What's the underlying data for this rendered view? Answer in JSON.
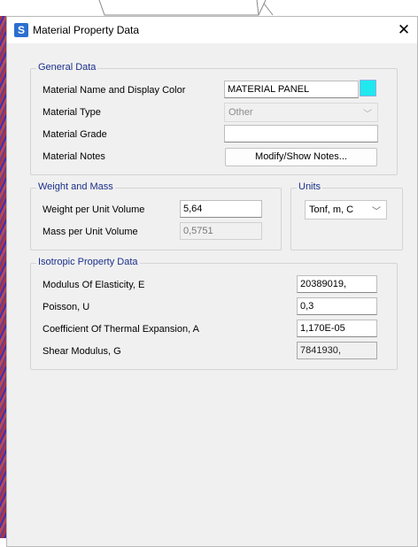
{
  "dialog": {
    "title": "Material Property Data",
    "app_icon_letter": "S"
  },
  "general": {
    "legend": "General Data",
    "name_label": "Material Name and Display Color",
    "name_value": "MATERIAL PANEL",
    "display_color": "#1fe8ee",
    "type_label": "Material Type",
    "type_value": "Other",
    "grade_label": "Material Grade",
    "grade_value": "",
    "notes_label": "Material Notes",
    "notes_button": "Modify/Show Notes..."
  },
  "weight": {
    "legend": "Weight and Mass",
    "weight_label": "Weight per Unit Volume",
    "weight_value": "5,64",
    "mass_label": "Mass per Unit Volume",
    "mass_value": "0,5751"
  },
  "units": {
    "legend": "Units",
    "value": "Tonf, m, C"
  },
  "isotropic": {
    "legend": "Isotropic Property Data",
    "e_label": "Modulus Of Elasticity,  E",
    "e_value": "20389019,",
    "u_label": "Poisson,  U",
    "u_value": "0,3",
    "a_label": "Coefficient Of Thermal Expansion,  A",
    "a_value": "1,170E-05",
    "g_label": "Shear Modulus,  G",
    "g_value": "7841930,"
  }
}
